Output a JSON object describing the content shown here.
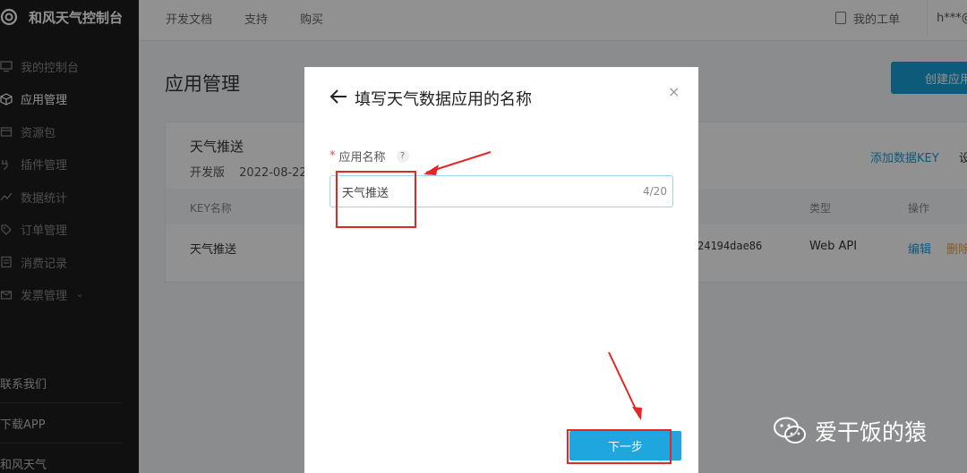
{
  "sidebar": {
    "brand": "和风天气控制台",
    "items": [
      {
        "label": "我的控制台",
        "icon": "monitor-icon",
        "active": false
      },
      {
        "label": "应用管理",
        "icon": "cube-icon",
        "active": true
      },
      {
        "label": "资源包",
        "icon": "package-icon",
        "active": false
      },
      {
        "label": "插件管理",
        "icon": "plugin-icon",
        "active": false
      },
      {
        "label": "数据统计",
        "icon": "chart-icon",
        "active": false
      },
      {
        "label": "订单管理",
        "icon": "tag-icon",
        "active": false
      },
      {
        "label": "消费记录",
        "icon": "receipt-icon",
        "active": false
      },
      {
        "label": "发票管理",
        "icon": "invoice-icon",
        "active": false
      }
    ],
    "bottom_links": [
      "联系我们",
      "下载APP",
      "和风天气"
    ]
  },
  "topbar": {
    "nav": [
      "开发文档",
      "支持",
      "购买"
    ],
    "ticket": "我的工单",
    "user": "h***@"
  },
  "page": {
    "title": "应用管理",
    "create_button": "创建应用"
  },
  "app_card": {
    "name": "天气推送",
    "plan": "开发版",
    "date": "2022-08-22",
    "add_key": "添加数据KEY",
    "settings": "设",
    "columns": [
      "KEY名称",
      "类型",
      "操作"
    ],
    "row": {
      "key_name": "天气推送",
      "key_fragment": "24194dae86",
      "type": "Web API",
      "edit": "编辑",
      "delete": "删除"
    }
  },
  "modal": {
    "title": "填写天气数据应用的名称",
    "field_label": "应用名称",
    "help": "?",
    "input_value": "天气推送",
    "counter": "4/20",
    "next_button": "下一步",
    "close": "×"
  },
  "watermark": {
    "text": "爱干饭的猿"
  },
  "colors": {
    "accent": "#1a9fd8",
    "sidebar_bg": "#1d1d1d",
    "annotation": "#e52626"
  }
}
